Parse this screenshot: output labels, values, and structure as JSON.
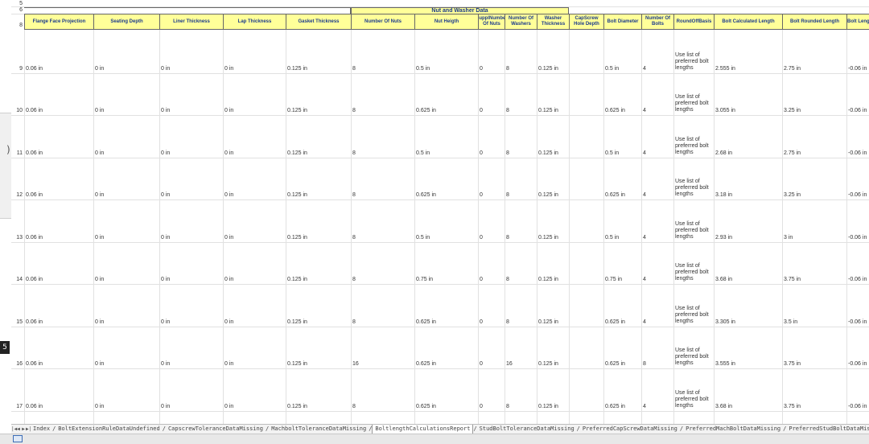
{
  "row_numbers_top": [
    "5",
    "6",
    "8"
  ],
  "group_headers": {
    "nut_washer": "Nut and Washer Data"
  },
  "columns": [
    "Flange Face Projection",
    "Seating Depth",
    "Liner Thickness",
    "Lap Thickness",
    "Gasket Thickness",
    "Number Of Nuts",
    "Nut Heigth",
    "SupplNumber Of Nuts",
    "Number Of Washers",
    "Washer Thickness",
    "CapScrew Hole Depth",
    "Bolt Diameter",
    "Number Of Bolts",
    "RoundOffBasis",
    "Bolt Calculated Length",
    "Bolt Rounded Length",
    "Bolt Length T"
  ],
  "rows": [
    {
      "num": "9",
      "cells": [
        "0.06 in",
        "0 in",
        "0 in",
        "0 in",
        "0.125 in",
        "8",
        "0.5 in",
        "0",
        "8",
        "0.125 in",
        "",
        "0.5 in",
        "4",
        "Use list of preferred bolt lengths",
        "2.555 in",
        "2.75 in",
        "-0.06 in"
      ]
    },
    {
      "num": "10",
      "cells": [
        "0.06 in",
        "0 in",
        "0 in",
        "0 in",
        "0.125 in",
        "8",
        "0.625 in",
        "0",
        "8",
        "0.125 in",
        "",
        "0.625 in",
        "4",
        "Use list of preferred bolt lengths",
        "3.055 in",
        "3.25 in",
        "-0.06 in"
      ]
    },
    {
      "num": "11",
      "cells": [
        "0.06 in",
        "0 in",
        "0 in",
        "0 in",
        "0.125 in",
        "8",
        "0.5 in",
        "0",
        "8",
        "0.125 in",
        "",
        "0.5 in",
        "4",
        "Use list of preferred bolt lengths",
        "2.68 in",
        "2.75 in",
        "-0.06 in"
      ]
    },
    {
      "num": "12",
      "cells": [
        "0.06 in",
        "0 in",
        "0 in",
        "0 in",
        "0.125 in",
        "8",
        "0.625 in",
        "0",
        "8",
        "0.125 in",
        "",
        "0.625 in",
        "4",
        "Use list of preferred bolt lengths",
        "3.18 in",
        "3.25 in",
        "-0.06 in"
      ]
    },
    {
      "num": "13",
      "cells": [
        "0.06 in",
        "0 in",
        "0 in",
        "0 in",
        "0.125 in",
        "8",
        "0.5 in",
        "0",
        "8",
        "0.125 in",
        "",
        "0.5 in",
        "4",
        "Use list of preferred bolt lengths",
        "2.93 in",
        "3 in",
        "-0.06 in"
      ]
    },
    {
      "num": "14",
      "cells": [
        "0.06 in",
        "0 in",
        "0 in",
        "0 in",
        "0.125 in",
        "8",
        "0.75 in",
        "0",
        "8",
        "0.125 in",
        "",
        "0.75 in",
        "4",
        "Use list of preferred bolt lengths",
        "3.68 in",
        "3.75 in",
        "-0.06 in"
      ]
    },
    {
      "num": "15",
      "cells": [
        "0.06 in",
        "0 in",
        "0 in",
        "0 in",
        "0.125 in",
        "8",
        "0.625 in",
        "0",
        "8",
        "0.125 in",
        "",
        "0.625 in",
        "4",
        "Use list of preferred bolt lengths",
        "3.305 in",
        "3.5 in",
        "-0.06 in"
      ]
    },
    {
      "num": "16",
      "cells": [
        "0.06 in",
        "0 in",
        "0 in",
        "0 in",
        "0.125 in",
        "16",
        "0.625 in",
        "0",
        "16",
        "0.125 in",
        "",
        "0.625 in",
        "8",
        "Use list of preferred bolt lengths",
        "3.555 in",
        "3.75 in",
        "-0.06 in"
      ]
    },
    {
      "num": "17",
      "cells": [
        "0.06 in",
        "0 in",
        "0 in",
        "0 in",
        "0.125 in",
        "8",
        "0.625 in",
        "0",
        "8",
        "0.125 in",
        "",
        "0.625 in",
        "4",
        "Use list of preferred bolt lengths",
        "3.68 in",
        "3.75 in",
        "-0.06 in"
      ]
    }
  ],
  "tabs": [
    "Index",
    "BoltExtensionRuleDataUndefined",
    "CapscrewToleranceDataMissing",
    "MachboltToleranceDataMissing",
    "BoltlengthCalculationsReport",
    "StudBoltToleranceDataMissing",
    "PreferredCapScrewDataMissing",
    "PreferredMachBoltDataMissing",
    "PreferredStudBoltDataMissing",
    "ReportOfBoltParts",
    "Bo"
  ],
  "active_tab_index": 4,
  "tab_nav": [
    "|◀",
    "◀",
    "▶",
    "▶|"
  ],
  "side_handle": ")",
  "side_badge": "5",
  "colors": {
    "header_fill": "#ffff99",
    "header_text": "#1c3b8c",
    "grid": "#e1e1e1"
  }
}
